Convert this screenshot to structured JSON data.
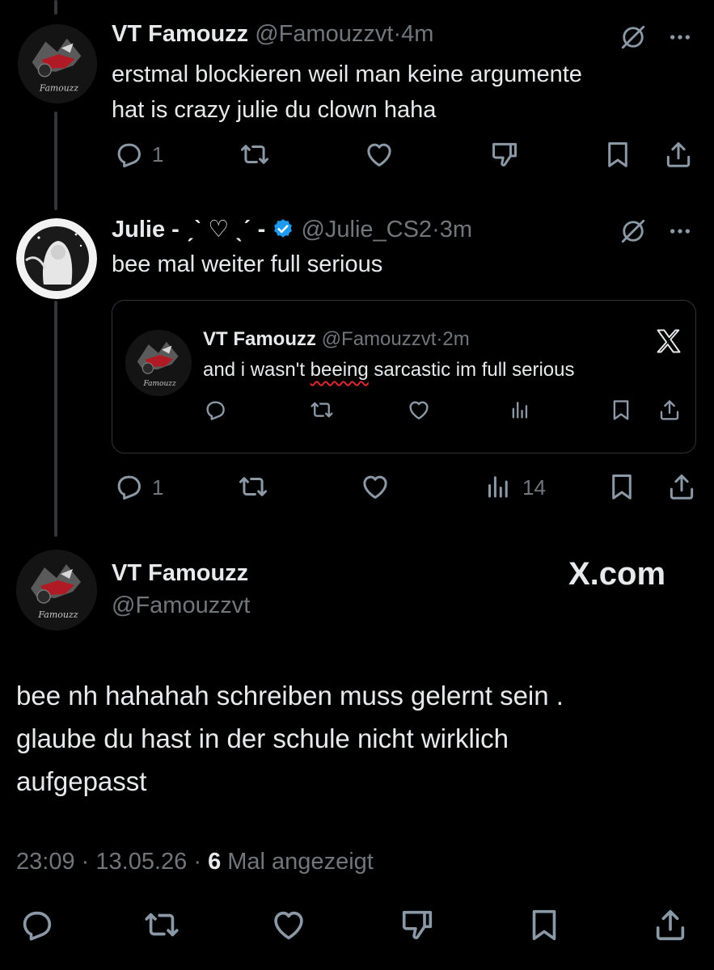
{
  "tweet1": {
    "display_name": "VT Famouzz",
    "handle": "@Famouzzvt",
    "time": "4m",
    "text_line1": "erstmal blockieren weil man keine argumente",
    "text_line2": "hat is crazy julie du clown haha",
    "reply_count": "1",
    "avatar_caption": "Famouzz"
  },
  "tweet2": {
    "display_name": "Julie - ˏˋ ♡ ˎˊ -",
    "handle": "@Julie_CS2",
    "time": "3m",
    "text": "bee mal weiter full serious",
    "reply_count": "1",
    "view_count": "14",
    "verified": true,
    "quote": {
      "display_name": "VT Famouzz",
      "handle": "@Famouzzvt",
      "time": "2m",
      "text_before": "and i wasn't ",
      "text_misspelled": "beeing",
      "text_after": " sarcastic im full serious",
      "avatar_caption": "Famouzz"
    }
  },
  "main_tweet": {
    "display_name": "VT Famouzz",
    "handle": "@Famouzzvt",
    "watermark": "X.com",
    "text_line1": "bee nh hahahah schreiben muss gelernt sein .",
    "text_line2": "glaube du hast in der schule nicht wirklich",
    "text_line3": "aufgepasst",
    "time": "23:09",
    "date": "13.05.26",
    "views": "6",
    "views_label": "Mal angezeigt",
    "avatar_caption": "Famouzz"
  },
  "separator": "·",
  "icons": {
    "reply": "reply-icon",
    "repost": "repost-icon",
    "like": "like-icon",
    "dislike": "dislike-icon",
    "views": "views-icon",
    "bookmark": "bookmark-icon",
    "share": "share-icon",
    "grok": "grok-icon",
    "more": "more-icon",
    "x_logo": "x-logo-icon",
    "verified": "verified-badge-icon"
  },
  "colors": {
    "background": "#000000",
    "text": "#e7e9ea",
    "muted": "#71767b",
    "verified": "#1d9bf0",
    "spellcheck": "#e0282e"
  }
}
